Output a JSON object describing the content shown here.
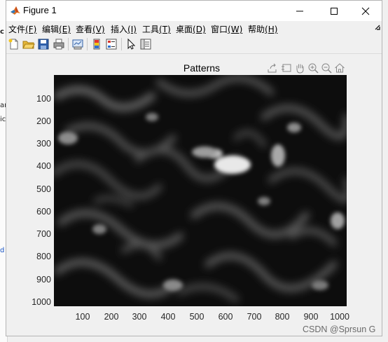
{
  "window": {
    "title": "Figure 1",
    "controls": [
      "minimize",
      "maximize",
      "close"
    ]
  },
  "menu": {
    "items": [
      {
        "label": "文件",
        "accel": "(F)"
      },
      {
        "label": "编辑",
        "accel": "(E)"
      },
      {
        "label": "查看",
        "accel": "(V)"
      },
      {
        "label": "插入",
        "accel": "(I)"
      },
      {
        "label": "工具",
        "accel": "(T)"
      },
      {
        "label": "桌面",
        "accel": "(D)"
      },
      {
        "label": "窗口",
        "accel": "(W)"
      },
      {
        "label": "帮助",
        "accel": "(H)"
      }
    ]
  },
  "toolbar": {
    "buttons": [
      "new-figure-icon",
      "open-file-icon",
      "save-figure-icon",
      "print-figure-icon",
      "link-plot-icon",
      "insert-colorbar-icon",
      "insert-legend-icon",
      "edit-plot-icon",
      "property-inspector-icon"
    ]
  },
  "axes": {
    "title": "Patterns",
    "yticks": [
      "100",
      "200",
      "300",
      "400",
      "500",
      "600",
      "700",
      "800",
      "900",
      "1000"
    ],
    "xticks": [
      "100",
      "200",
      "300",
      "400",
      "500",
      "600",
      "700",
      "800",
      "900",
      "1000"
    ],
    "tools": [
      "export-icon",
      "brush-icon",
      "pan-hand-icon",
      "zoom-in-icon",
      "zoom-out-icon",
      "home-icon"
    ]
  },
  "chart_data": {
    "type": "heatmap",
    "title": "Patterns",
    "xlim": [
      1,
      1024
    ],
    "ylim": [
      1,
      1024
    ],
    "colormap": "gray",
    "grid": false
  },
  "background_app": {
    "fragments": [
      "c",
      "ar",
      "ic",
      "d"
    ]
  },
  "watermark": "CSDN @Sprsun G"
}
